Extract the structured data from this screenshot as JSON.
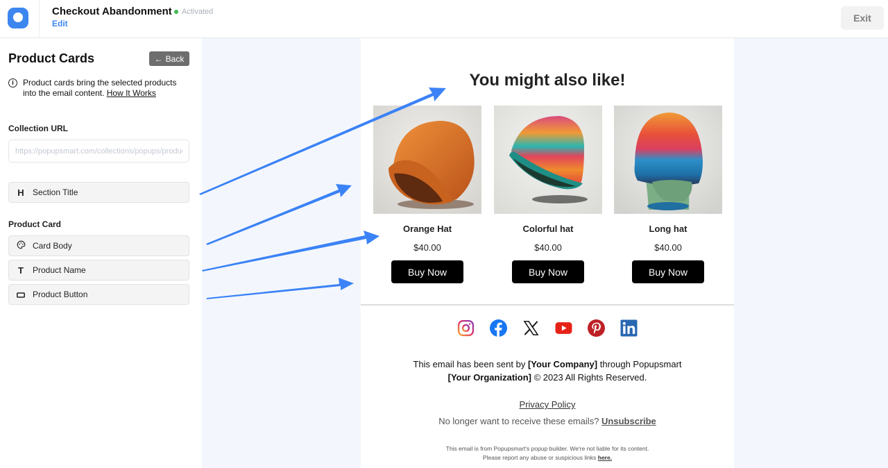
{
  "header": {
    "title": "Checkout Abandonment",
    "status": "Activated",
    "edit_label": "Edit",
    "exit_label": "Exit"
  },
  "sidebar": {
    "title": "Product Cards",
    "back_label": "Back",
    "info_text": "Product cards bring the selected products into the email content.",
    "info_link": "How It Works",
    "collection_url_label": "Collection URL",
    "collection_url_placeholder": "https://popupsmart.com/collections/popups/products",
    "section_title_option": {
      "label": "Section Title",
      "icon": "heading-icon"
    },
    "product_card_label": "Product Card",
    "product_card_options": [
      {
        "label": "Card Body",
        "icon": "palette-icon"
      },
      {
        "label": "Product Name",
        "icon": "text-icon"
      },
      {
        "label": "Product Button",
        "icon": "button-icon"
      }
    ]
  },
  "email": {
    "heading": "You might also like!",
    "products": [
      {
        "name": "Orange Hat",
        "price": "$40.00",
        "button": "Buy Now"
      },
      {
        "name": "Colorful hat",
        "price": "$40.00",
        "button": "Buy Now"
      },
      {
        "name": "Long hat",
        "price": "$40.00",
        "button": "Buy Now"
      }
    ],
    "social_icons": [
      "instagram-icon",
      "facebook-icon",
      "x-icon",
      "youtube-icon",
      "pinterest-icon",
      "linkedin-icon"
    ],
    "footer": {
      "sent_by_prefix": "This email has been sent by ",
      "company": "[Your Company]",
      "sent_by_suffix": " through Popupsmart",
      "organization": "[Your Organization]",
      "rights": " © 2023 All Rights Reserved.",
      "privacy_policy": "Privacy Policy",
      "unsubscribe_prompt": "No longer want to receive these emails? ",
      "unsubscribe_label": "Unsubscribe",
      "disclaimer_line1": "This email is from Popupsmart's popup builder. We're not liable for its content.",
      "disclaimer_line2": "Please report any abuse or suspicious links ",
      "report_link": "here."
    }
  },
  "colors": {
    "brand": "#3d86f0",
    "status_green": "#3fb950",
    "annotation_arrow": "#3b82f6",
    "canvas_bg": "#f3f7fd"
  }
}
